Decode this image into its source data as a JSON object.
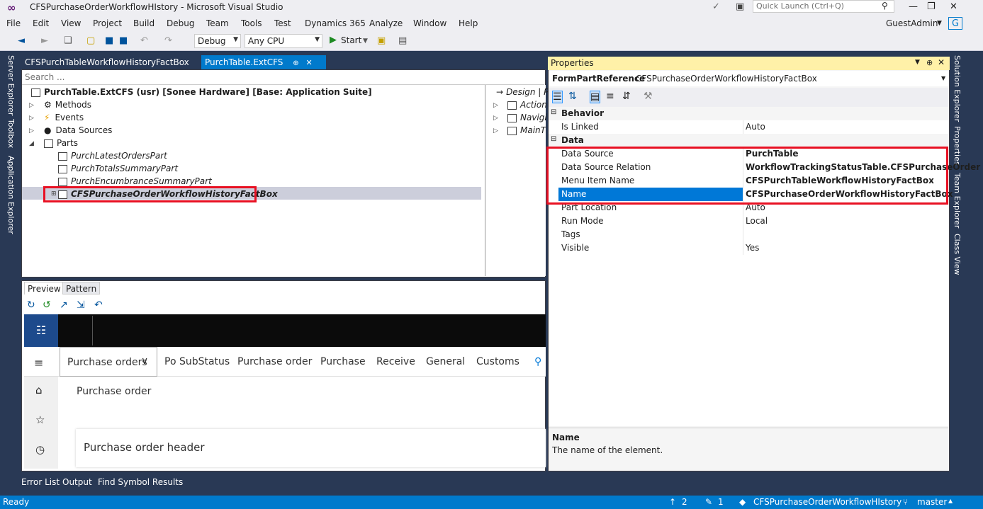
{
  "window": {
    "title": "CFSPurchaseOrderWorkflowHIstory - Microsoft Visual Studio",
    "quick_launch_placeholder": "Quick Launch (Ctrl+Q)",
    "user": "GuestAdmin",
    "user_initial": "G"
  },
  "menu": [
    "File",
    "Edit",
    "View",
    "Project",
    "Build",
    "Debug",
    "Team",
    "Tools",
    "Test",
    "Dynamics 365",
    "Analyze",
    "Window",
    "Help"
  ],
  "toolbar": {
    "config": "Debug",
    "platform": "Any CPU",
    "start_label": "Start"
  },
  "left_sidebar": [
    "Server Explorer",
    "Toolbox",
    "Application Explorer"
  ],
  "right_sidebar": [
    "Solution Explorer",
    "Properties",
    "Team Explorer",
    "Class View"
  ],
  "doc_tabs": [
    {
      "label": "CFSPurchTableWorkflowHistoryFactBox"
    },
    {
      "label": "PurchTable.ExtCFS"
    }
  ],
  "designer": {
    "search_placeholder": "Search ...",
    "root": "PurchTable.ExtCFS (usr) [Sonee Hardware] [Base: Application Suite]",
    "nodes": [
      "Methods",
      "Events",
      "Data Sources",
      "Parts"
    ],
    "parts": [
      "PurchLatestOrdersPart",
      "PurchTotalsSummaryPart",
      "PurchEncumbranceSummaryPart",
      "CFSPurchaseOrderWorkflowHistoryFactBox"
    ],
    "right_items": [
      "Design | P",
      "Action",
      "Navigi",
      "MainT"
    ]
  },
  "preview": {
    "tabs": [
      "Preview",
      "Pattern"
    ],
    "nav_items": [
      "Purchase orders",
      "Po SubStatus",
      "Purchase order",
      "Purchase",
      "Receive",
      "General",
      "Customs"
    ],
    "breadcrumb": "Purchase order",
    "section_header": "Purchase order header"
  },
  "properties": {
    "title": "Properties",
    "object_type": "FormPartReference",
    "object_name": "CFSPurchaseOrderWorkflowHistoryFactBox",
    "categories": [
      {
        "name": "Behavior",
        "rows": [
          {
            "name": "Is Linked",
            "value": "Auto",
            "bold": false
          }
        ]
      },
      {
        "name": "Data",
        "rows": [
          {
            "name": "Data Source",
            "value": "PurchTable",
            "bold": true
          },
          {
            "name": "Data Source Relation",
            "value": "WorkflowTrackingStatusTable.CFSPurchaseOrder",
            "bold": true
          },
          {
            "name": "Menu Item Name",
            "value": "CFSPurchTableWorkflowHistoryFactBox",
            "bold": true
          },
          {
            "name": "Name",
            "value": "CFSPurchaseOrderWorkflowHistoryFactBox",
            "bold": true
          },
          {
            "name": "Part Location",
            "value": "Auto",
            "bold": false
          },
          {
            "name": "Run Mode",
            "value": "Local",
            "bold": false
          },
          {
            "name": "Tags",
            "value": "",
            "bold": false
          },
          {
            "name": "Visible",
            "value": "Yes",
            "bold": false
          }
        ]
      }
    ],
    "desc_title": "Name",
    "desc_text": "The name of the element."
  },
  "bottom_tabs": [
    "Error List",
    "Output",
    "Find Symbol Results"
  ],
  "status": {
    "ready": "Ready",
    "up_count": "2",
    "pencil_count": "1",
    "repo": "CFSPurchaseOrderWorkflowHIstory",
    "branch": "master"
  },
  "colors": {
    "accent": "#007acc",
    "highlight": "#e81123",
    "selection": "#0078d7"
  }
}
